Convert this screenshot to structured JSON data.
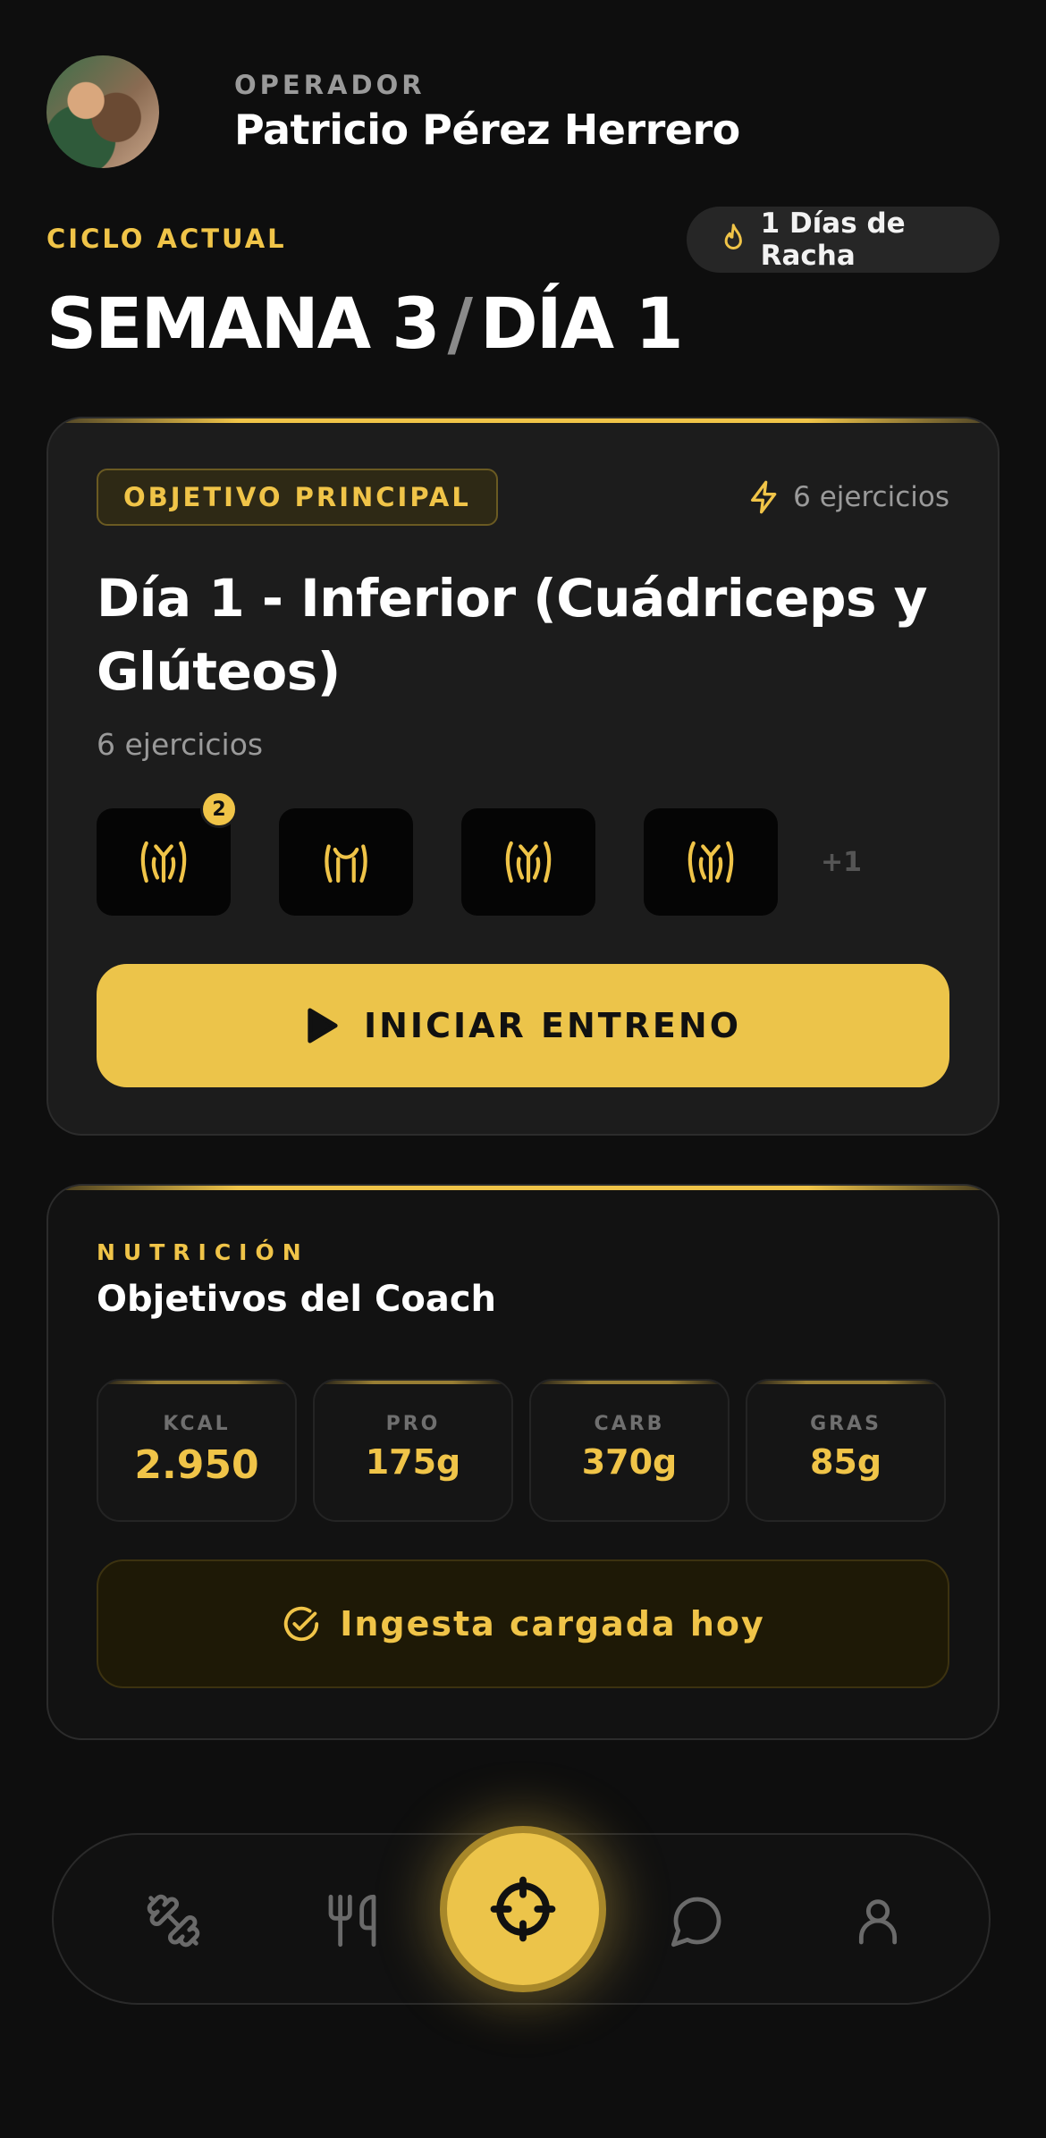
{
  "user": {
    "role": "OPERADOR",
    "name": "Patricio Pérez Herrero"
  },
  "cycle": {
    "label": "CICLO ACTUAL",
    "week": "SEMANA 3",
    "separator": "/",
    "day": "DÍA 1"
  },
  "streak": {
    "text": "1 Días de Racha",
    "icon": "flame-icon"
  },
  "workout": {
    "badge": "OBJETIVO PRINCIPAL",
    "exercise_count_label": "6 ejercicios",
    "title": "Día 1 - Inferior (Cuádriceps y Glúteos)",
    "subtitle": "6 ejercicios",
    "thumb_badge": "2",
    "more_label": "+1",
    "start_label": "INICIAR ENTRENO"
  },
  "nutrition": {
    "label": "NUTRICIÓN",
    "title": "Objetivos del Coach",
    "macros": [
      {
        "label": "KCAL",
        "value": "2.950"
      },
      {
        "label": "PRO",
        "value": "175g"
      },
      {
        "label": "CARB",
        "value": "370g"
      },
      {
        "label": "GRAS",
        "value": "85g"
      }
    ],
    "intake_label": "Ingesta cargada hoy"
  },
  "nav": {
    "items": [
      "dumbbell-icon",
      "fork-knife-icon",
      "crosshair-icon",
      "chat-icon",
      "user-icon"
    ],
    "active": "crosshair-icon"
  },
  "colors": {
    "accent": "#F0C448",
    "background": "#0E0E0E",
    "card": "#1C1C1C"
  }
}
